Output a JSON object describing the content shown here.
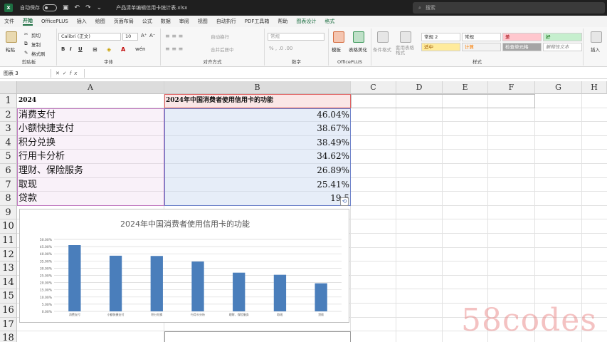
{
  "titlebar": {
    "autosave_label": "自动保存",
    "autosave_state": "关",
    "filename": "产品清单编辑信用卡统计表.xlsx",
    "search_placeholder": "搜索"
  },
  "tabs": [
    {
      "label": "文件",
      "active": false,
      "ctx": false
    },
    {
      "label": "开始",
      "active": true,
      "ctx": false
    },
    {
      "label": "OfficePLUS",
      "active": false,
      "ctx": false
    },
    {
      "label": "插入",
      "active": false,
      "ctx": false
    },
    {
      "label": "绘图",
      "active": false,
      "ctx": false
    },
    {
      "label": "页面布局",
      "active": false,
      "ctx": false
    },
    {
      "label": "公式",
      "active": false,
      "ctx": false
    },
    {
      "label": "数据",
      "active": false,
      "ctx": false
    },
    {
      "label": "审阅",
      "active": false,
      "ctx": false
    },
    {
      "label": "视图",
      "active": false,
      "ctx": false
    },
    {
      "label": "自动执行",
      "active": false,
      "ctx": false
    },
    {
      "label": "PDF工具箱",
      "active": false,
      "ctx": false
    },
    {
      "label": "帮助",
      "active": false,
      "ctx": false
    },
    {
      "label": "图表设计",
      "active": false,
      "ctx": true
    },
    {
      "label": "格式",
      "active": false,
      "ctx": true
    }
  ],
  "ribbon": {
    "clipboard": {
      "label": "剪贴板",
      "paste": "粘贴",
      "cut": "剪切",
      "copy": "复制",
      "format_painter": "格式刷"
    },
    "font": {
      "label": "字体",
      "font_name": "Calibri (正文)",
      "font_size": "10",
      "bold": "B",
      "italic": "I",
      "underline": "U"
    },
    "alignment": {
      "label": "对齐方式",
      "wrap": "自动换行",
      "merge": "合并后居中"
    },
    "number": {
      "label": "数字",
      "format": "常规"
    },
    "officeplus": {
      "label": "OfficePLUS",
      "template": "模板",
      "beautify": "表格美化"
    },
    "cond_format": "条件格式",
    "table_format": "套用表格格式",
    "styles": {
      "label": "样式",
      "items": [
        "常规 2",
        "常规",
        "差",
        "好",
        "适中",
        "计算",
        "检查单元格",
        "解释性文本"
      ]
    },
    "insert_label": "插入"
  },
  "formula_bar": {
    "name_box": "图表 3",
    "fx": "fx",
    "content": ""
  },
  "columns": [
    "A",
    "B",
    "C",
    "D",
    "E",
    "F",
    "G",
    "H"
  ],
  "rows": [
    "1",
    "2",
    "3",
    "4",
    "5",
    "6",
    "7",
    "8",
    "9",
    "10",
    "11",
    "12",
    "13",
    "14",
    "15",
    "16",
    "17",
    "18"
  ],
  "sheet": {
    "a1": "2024",
    "b1": "2024年中国消费者使用信用卡的功能",
    "data_rows": [
      {
        "label": "消费支付",
        "value": "46.04%"
      },
      {
        "label": "小额快捷支付",
        "value": "38.67%"
      },
      {
        "label": "积分兑换",
        "value": "38.49%"
      },
      {
        "label": "行用卡分析",
        "value": "34.62%"
      },
      {
        "label": "理财、保险服务",
        "value": "26.89%"
      },
      {
        "label": "取现",
        "value": "25.41%"
      },
      {
        "label": "贷款",
        "value": "19.5"
      }
    ]
  },
  "chart_data": {
    "type": "bar",
    "title": "2024年中国消费者使用信用卡的功能",
    "categories": [
      "消费支付",
      "小额快捷支付",
      "积分兑换",
      "行用卡分析",
      "理财、保险服务",
      "取现",
      "贷款"
    ],
    "values": [
      46.04,
      38.67,
      38.49,
      34.62,
      26.89,
      25.41,
      19.5
    ],
    "yticks": [
      "0.00%",
      "5.00%",
      "10.00%",
      "15.00%",
      "20.00%",
      "25.00%",
      "30.00%",
      "35.00%",
      "40.00%",
      "45.00%",
      "50.00%"
    ],
    "ylim": [
      0,
      50
    ],
    "bar_color": "#4a7ebb",
    "grid": true
  },
  "watermark": "58codes"
}
